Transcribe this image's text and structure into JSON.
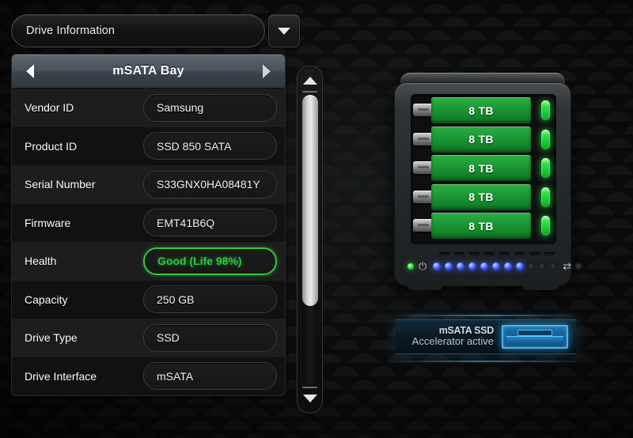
{
  "dropdown": {
    "selected": "Drive Information",
    "arrow_icon": "chevron-down-icon"
  },
  "bay_header": {
    "title": "mSATA Bay",
    "prev_icon": "arrow-left-icon",
    "next_icon": "arrow-right-icon"
  },
  "info_rows": [
    {
      "label": "Vendor ID",
      "value": "Samsung"
    },
    {
      "label": "Product ID",
      "value": "SSD 850 SATA"
    },
    {
      "label": "Serial Number",
      "value": "S33GNX0HA08481Y"
    },
    {
      "label": "Firmware",
      "value": "EMT41B6Q"
    },
    {
      "label": "Health",
      "value": "Good (Life 98%)",
      "status": "good"
    },
    {
      "label": "Capacity",
      "value": "250 GB"
    },
    {
      "label": "Drive Type",
      "value": "SSD"
    },
    {
      "label": "Drive Interface",
      "value": "mSATA"
    }
  ],
  "scrollbar": {
    "up_icon": "arrow-up-icon",
    "down_icon": "arrow-down-icon"
  },
  "nas": {
    "bays": [
      {
        "capacity": "8 TB",
        "led": "green"
      },
      {
        "capacity": "8 TB",
        "led": "green"
      },
      {
        "capacity": "8 TB",
        "led": "green"
      },
      {
        "capacity": "8 TB",
        "led": "green"
      },
      {
        "capacity": "8 TB",
        "led": "green"
      }
    ],
    "power_glyph": "⏻",
    "network_glyph": "⇄",
    "leds_blue_on": 8,
    "leds_off": 3,
    "vents": 8
  },
  "accelerator": {
    "line1": "mSATA SSD",
    "line2": "Accelerator active"
  },
  "colors": {
    "health_green": "#2ecc40",
    "bay_green": "#1e9c37",
    "led_blue": "#3b5bff",
    "accent_cyan": "#3fb6f2",
    "header_slate": "#4a545d"
  }
}
